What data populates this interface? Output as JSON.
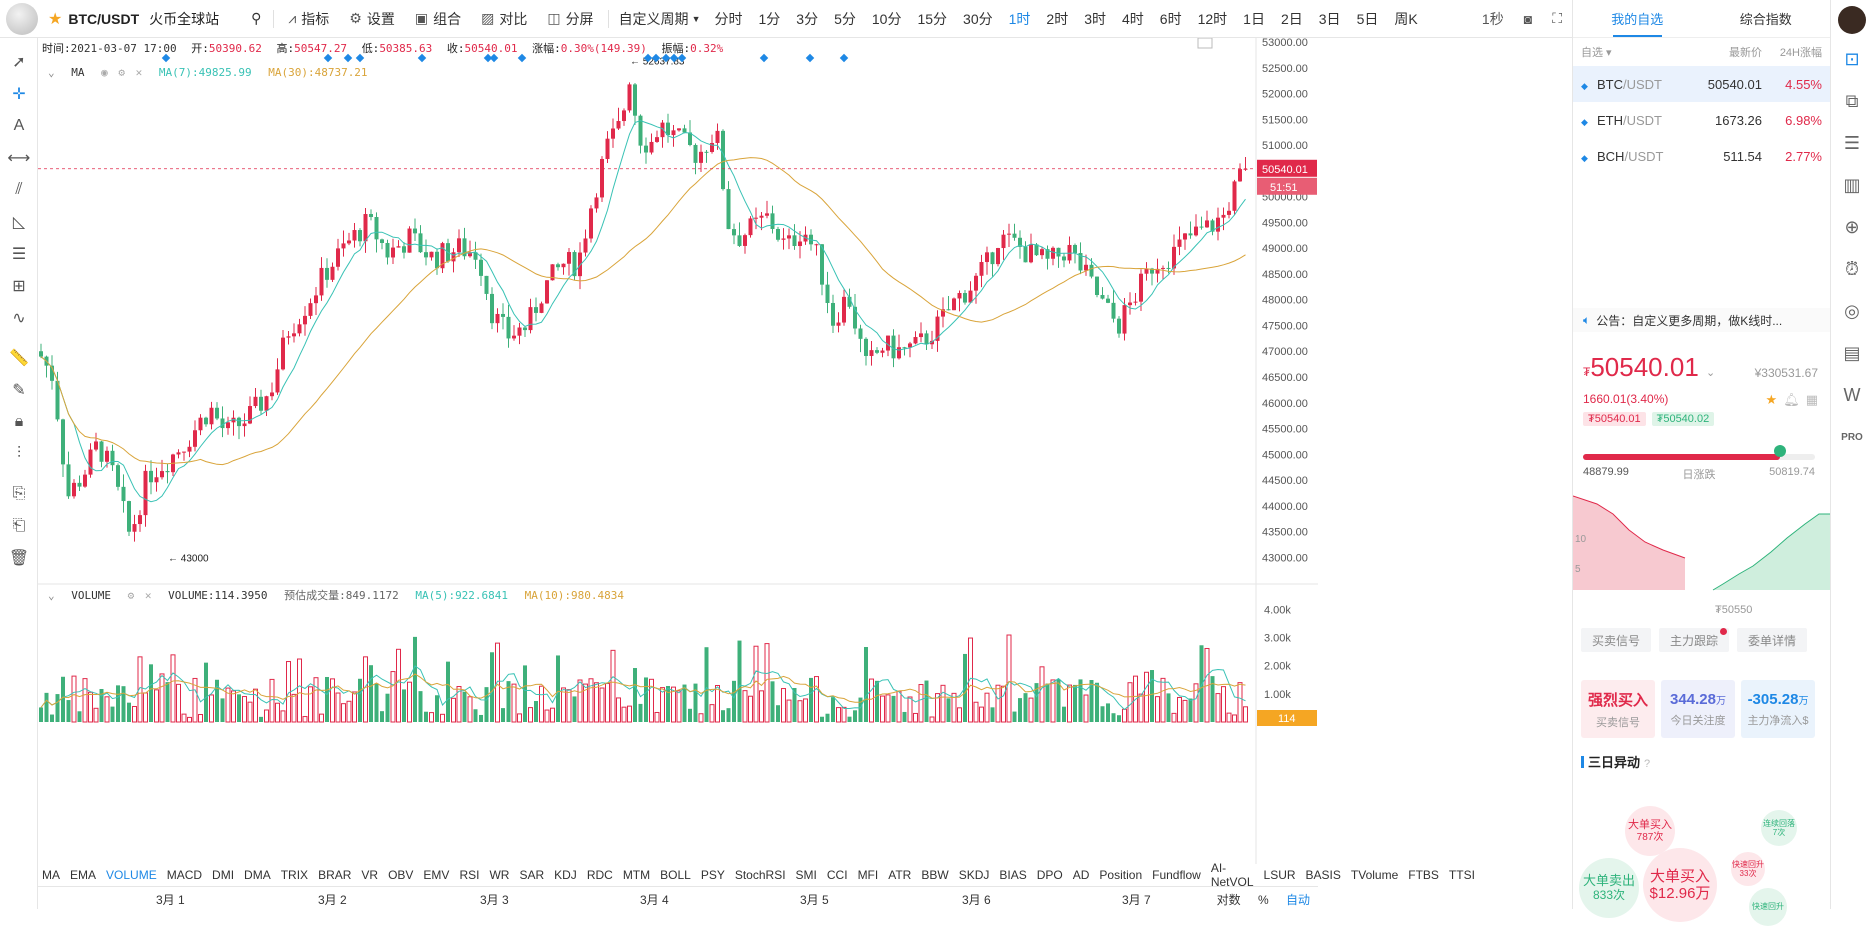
{
  "header": {
    "symbol": "BTC/USDT",
    "venue": "火币全球站",
    "toolbar": [
      {
        "icon": "indicator-icon",
        "label": "指标"
      },
      {
        "icon": "gear-icon",
        "label": "设置"
      },
      {
        "icon": "combo-icon",
        "label": "组合"
      },
      {
        "icon": "compare-icon",
        "label": "对比"
      },
      {
        "icon": "split-icon",
        "label": "分屏"
      }
    ],
    "custom_period": "自定义周期",
    "periods": [
      "分时",
      "1分",
      "3分",
      "5分",
      "10分",
      "15分",
      "30分",
      "1时",
      "2时",
      "3时",
      "4时",
      "6时",
      "12时",
      "1日",
      "2日",
      "3日",
      "5日",
      "周K"
    ],
    "active_period": "1时",
    "interval": "1秒"
  },
  "ohlc": {
    "time_label": "时间:",
    "time": "2021-03-07 17:00",
    "open_label": "开:",
    "open": "50390.62",
    "high_label": "高:",
    "high": "50547.27",
    "low_label": "低:",
    "low": "50385.63",
    "close_label": "收:",
    "close": "50540.01",
    "change_label": "涨幅:",
    "change": "0.30%(149.39)",
    "amp_label": "振幅:",
    "amp": "0.32%"
  },
  "ma_legend": {
    "name": "MA",
    "ma7": "MA(7):49825.99",
    "ma30": "MA(30):48737.21"
  },
  "vol_legend": {
    "name": "VOLUME",
    "volume": "VOLUME:114.3950",
    "est": "预估成交量:849.1172",
    "ma5": "MA(5):922.6841",
    "ma10": "MA(10):980.4834"
  },
  "price_axis": [
    "53000.00",
    "52500.00",
    "52000.00",
    "51500.00",
    "51000.00",
    "50500.00",
    "50000.00",
    "49500.00",
    "49000.00",
    "48500.00",
    "48000.00",
    "47500.00",
    "47000.00",
    "46500.00",
    "46000.00",
    "45500.00",
    "45000.00",
    "44500.00",
    "44000.00",
    "43500.00",
    "43000.00"
  ],
  "current_price_tag": "50540.01",
  "countdown_tag": "51:51",
  "high_marker": "← 52637.83",
  "low_marker": "← 43000",
  "vol_axis": [
    "4.00k",
    "3.00k",
    "2.00k",
    "1.00k"
  ],
  "vol_tag": "114",
  "indicator_tabs": [
    "MA",
    "EMA",
    "VOLUME",
    "MACD",
    "DMI",
    "DMA",
    "TRIX",
    "BRAR",
    "VR",
    "OBV",
    "EMV",
    "RSI",
    "WR",
    "SAR",
    "KDJ",
    "RDC",
    "MTM",
    "BOLL",
    "PSY",
    "StochRSI",
    "SMI",
    "CCI",
    "MFI",
    "ATR",
    "BBW",
    "SKDJ",
    "BIAS",
    "DPO",
    "AD",
    "Position",
    "Fundflow",
    "AI-NetVOL",
    "LSUR",
    "BASIS",
    "TVolume",
    "FTBS",
    "TTSI"
  ],
  "active_indicators": [
    "VOLUME"
  ],
  "date_labels": [
    "3月 1",
    "3月 2",
    "3月 3",
    "3月 4",
    "3月 5",
    "3月 6",
    "3月 7"
  ],
  "axis_modes": [
    "对数",
    "%",
    "自动"
  ],
  "colors": {
    "up": "#e0294a",
    "down": "#3eb07a",
    "ma7": "#39c2b5",
    "ma30": "#d9a43a",
    "accent": "#1e88e5"
  },
  "chart_data": {
    "type": "candlestick",
    "title": "",
    "x_ticks": [
      "3月 1",
      "3月 2",
      "3月 3",
      "3月 4",
      "3月 5",
      "3月 6",
      "3月 7"
    ],
    "ylim": [
      42600,
      53000
    ],
    "high": 52637.83,
    "low": 43000,
    "last": 50540.01,
    "series": [
      {
        "name": "MA(7)",
        "last": 49825.99
      },
      {
        "name": "MA(30)",
        "last": 48737.21
      }
    ]
  },
  "right_panel": {
    "tabs": [
      "我的自选",
      "综合指数"
    ],
    "active_tab": "我的自选",
    "list_head": {
      "group": "自选 ▾",
      "price": "最新价",
      "change": "24H涨幅"
    },
    "rows": [
      {
        "base": "BTC",
        "quote": "/USDT",
        "price": "50540.01",
        "change": "4.55%"
      },
      {
        "base": "ETH",
        "quote": "/USDT",
        "price": "1673.26",
        "change": "6.98%"
      },
      {
        "base": "BCH",
        "quote": "/USDT",
        "price": "511.54",
        "change": "2.77%"
      }
    ],
    "notice": "公告：自定义更多周期，做K线时...",
    "price": "50540.01",
    "price_prefix": "₮",
    "price_cny": "¥330531.67",
    "change": "1660.01(3.40%)",
    "bid": "₮50540.01",
    "ask": "₮50540.02",
    "range_low": "48879.99",
    "range_label": "日涨跌",
    "range_high": "50819.74",
    "range_fraction": 0.85,
    "depth_label": "₮50550",
    "depth_axis": [
      "10",
      "5"
    ],
    "signal_tabs": [
      "买卖信号",
      "主力跟踪",
      "委单详情"
    ],
    "stats": [
      {
        "value": "强烈买入",
        "unit": "",
        "label": "买卖信号"
      },
      {
        "value": "344.28",
        "unit": "万",
        "label": "今日关注度"
      },
      {
        "value": "-305.28",
        "unit": "万",
        "label": "主力净流入$"
      }
    ],
    "sanri": "三日异动",
    "bubbles": [
      {
        "title": "大单买入",
        "sub": "787次"
      },
      {
        "title": "大单卖出",
        "sub": "833次"
      },
      {
        "title": "大单买入",
        "sub": "$12.96万"
      },
      {
        "title": "连续回落",
        "sub": "7次"
      },
      {
        "title": "快速回升",
        "sub": "33次"
      },
      {
        "title": "快速回升",
        "sub": ""
      }
    ]
  }
}
